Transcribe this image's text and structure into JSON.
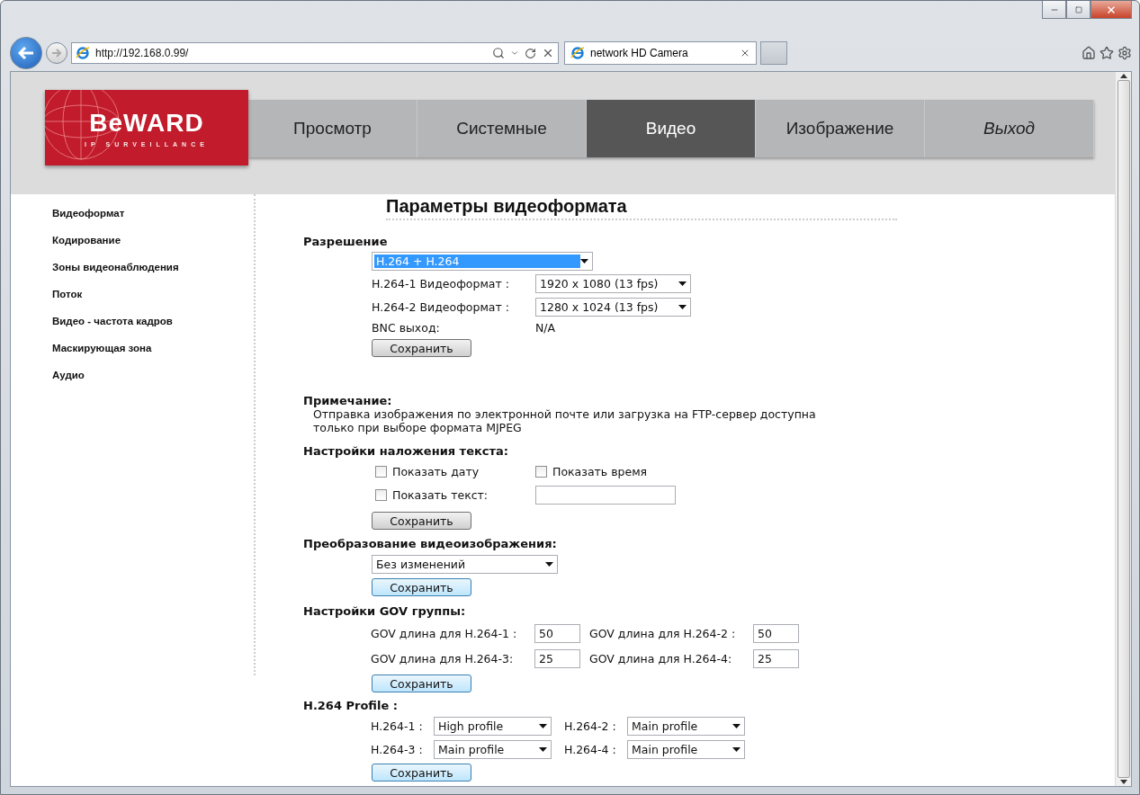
{
  "browser": {
    "address": "http://192.168.0.99/",
    "tabs": [
      {
        "title": "network HD Camera",
        "selected": true
      }
    ]
  },
  "header": {
    "logo": {
      "brand": "BeWARD",
      "tagline": "IP SURVEILLANCE"
    },
    "nav": [
      {
        "label": "Просмотр",
        "selected": false,
        "kind": "page"
      },
      {
        "label": "Системные",
        "selected": false,
        "kind": "page"
      },
      {
        "label": "Видео",
        "selected": true,
        "kind": "page"
      },
      {
        "label": "Изображение",
        "selected": false,
        "kind": "page"
      },
      {
        "label": "Выход",
        "selected": false,
        "kind": "exit"
      }
    ]
  },
  "sidebar": {
    "items": [
      {
        "label": "Видеоформат"
      },
      {
        "label": "Кодирование"
      },
      {
        "label": "Зоны видеонаблюдения"
      },
      {
        "label": "Поток"
      },
      {
        "label": "Видео - частота кадров"
      },
      {
        "label": "Маскирующая зона"
      },
      {
        "label": "Аудио"
      }
    ]
  },
  "title": "Параметры видеоформата",
  "resolution": {
    "heading": "Разрешение",
    "select": {
      "value": "H.264 + H.264",
      "focused": true
    },
    "rows": [
      {
        "label": "H.264-1 Видеоформат :",
        "value": "1920 x 1080 (13 fps)"
      },
      {
        "label": "H.264-2 Видеоформат :",
        "value": "1280 x 1024 (13 fps)"
      }
    ],
    "bnc": {
      "label": "BNC выход:",
      "value": "N/A"
    },
    "save": {
      "label": "Сохранить",
      "highlighted": false
    }
  },
  "note": {
    "heading": "Примечание:",
    "text": "Отправка изображения по электронной почте или загрузка на FTP-сервер доступна только при выборе формата MJPEG"
  },
  "overlay": {
    "heading": "Настройки наложения текста:",
    "checkboxes": [
      {
        "label": "Показать дату",
        "checked": false
      },
      {
        "label": "Показать время",
        "checked": false
      },
      {
        "label": "Показать текст:",
        "checked": false
      }
    ],
    "save": {
      "label": "Сохранить",
      "highlighted": false
    }
  },
  "transform": {
    "heading": "Преобразование видеоизображения:",
    "select": {
      "value": "Без изменений"
    },
    "save": {
      "label": "Сохранить",
      "highlighted": true
    }
  },
  "gov": {
    "heading": "Настройки GOV группы:",
    "fields": [
      {
        "label": "GOV длина для H.264-1 :",
        "value": "50"
      },
      {
        "label": "GOV длина для H.264-2 :",
        "value": "50"
      },
      {
        "label": "GOV длина для H.264-3:",
        "value": "25"
      },
      {
        "label": "GOV длина для H.264-4:",
        "value": "25"
      }
    ],
    "save": {
      "label": "Сохранить",
      "highlighted": true
    }
  },
  "profile": {
    "heading": "H.264 Profile :",
    "fields": [
      {
        "label": "H.264-1 :",
        "value": "High profile"
      },
      {
        "label": "H.264-2 :",
        "value": "Main profile"
      },
      {
        "label": "H.264-3 :",
        "value": "Main profile"
      },
      {
        "label": "H.264-4 :",
        "value": "Main profile"
      }
    ],
    "save": {
      "label": "Сохранить",
      "highlighted": true
    }
  }
}
